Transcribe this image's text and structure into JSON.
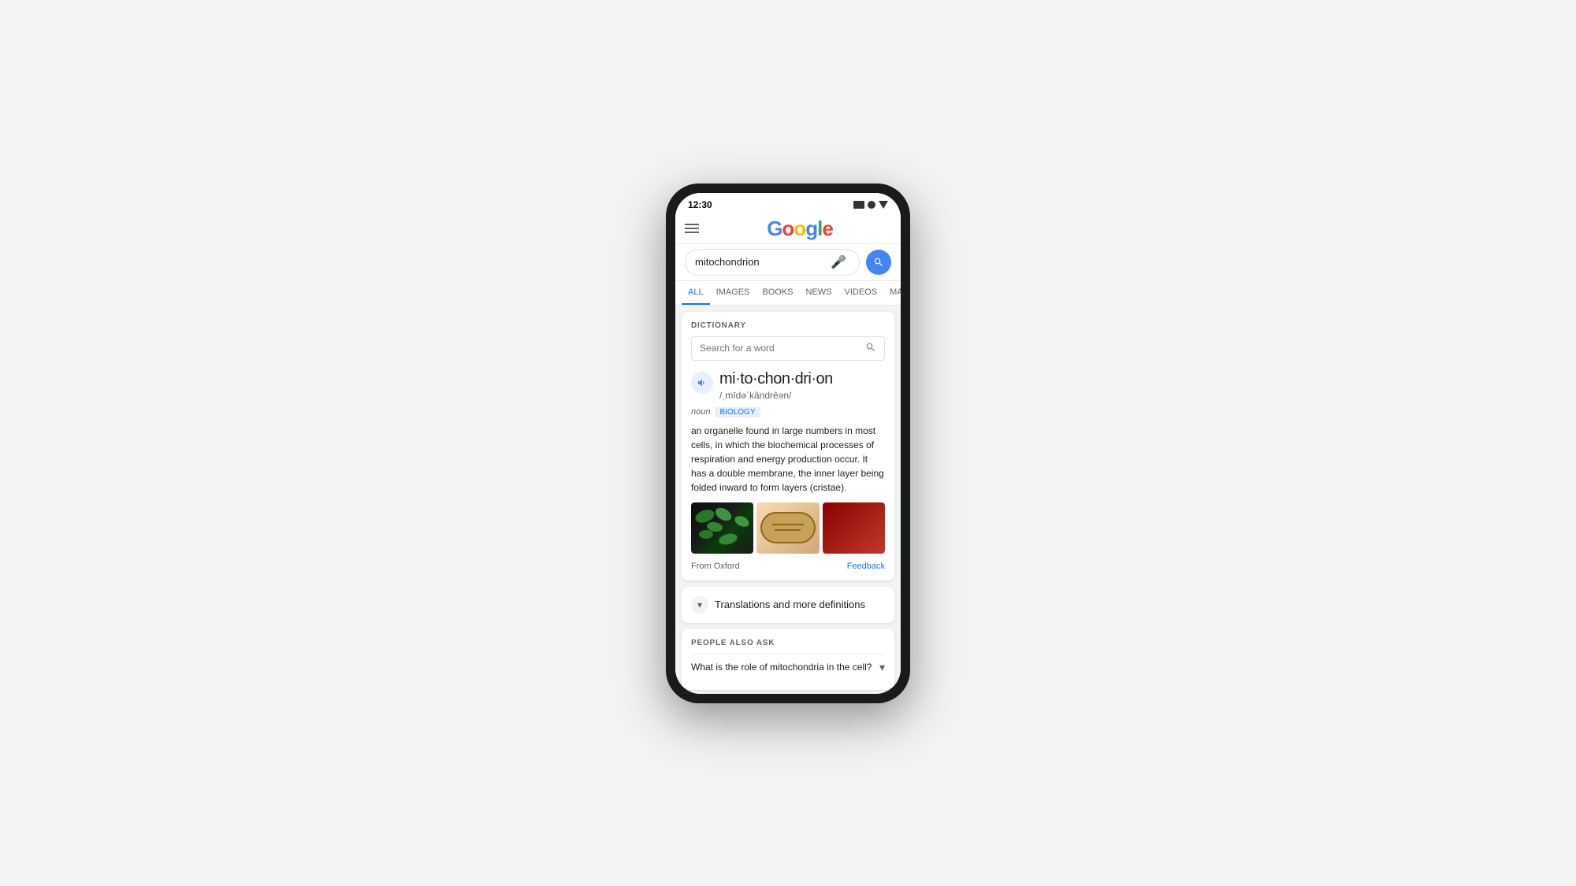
{
  "phone": {
    "status_bar": {
      "time": "12:30"
    }
  },
  "header": {
    "menu_label": "Menu",
    "logo": {
      "g1": "G",
      "o1": "o",
      "o2": "o",
      "g2": "g",
      "l": "l",
      "e": "e"
    }
  },
  "search": {
    "query": "mitochondrion",
    "mic_label": "Voice search",
    "search_label": "Search"
  },
  "tabs": [
    {
      "label": "ALL",
      "active": true
    },
    {
      "label": "IMAGES",
      "active": false
    },
    {
      "label": "BOOKS",
      "active": false
    },
    {
      "label": "NEWS",
      "active": false
    },
    {
      "label": "VIDEOS",
      "active": false
    },
    {
      "label": "MA...",
      "active": false
    }
  ],
  "dictionary": {
    "section_label": "DICTIONARY",
    "search_placeholder": "Search for a word",
    "word": "mi·to·chon·dri·on",
    "pronunciation": "/ˌmīdəˈkändrēən/",
    "part_of_speech": "noun",
    "subject_tag": "BIOLOGY",
    "definition": "an organelle found in large numbers in most cells, in which the biochemical processes of respiration and energy production occur. It has a double membrane, the inner layer being folded inward to form layers (cristae).",
    "from_label": "From Oxford",
    "feedback_label": "Feedback"
  },
  "translations": {
    "label": "Translations and more definitions"
  },
  "people_also_ask": {
    "section_label": "PEOPLE ALSO ASK",
    "questions": [
      {
        "text": "What is the role of mitochondria in the cell?"
      }
    ]
  }
}
